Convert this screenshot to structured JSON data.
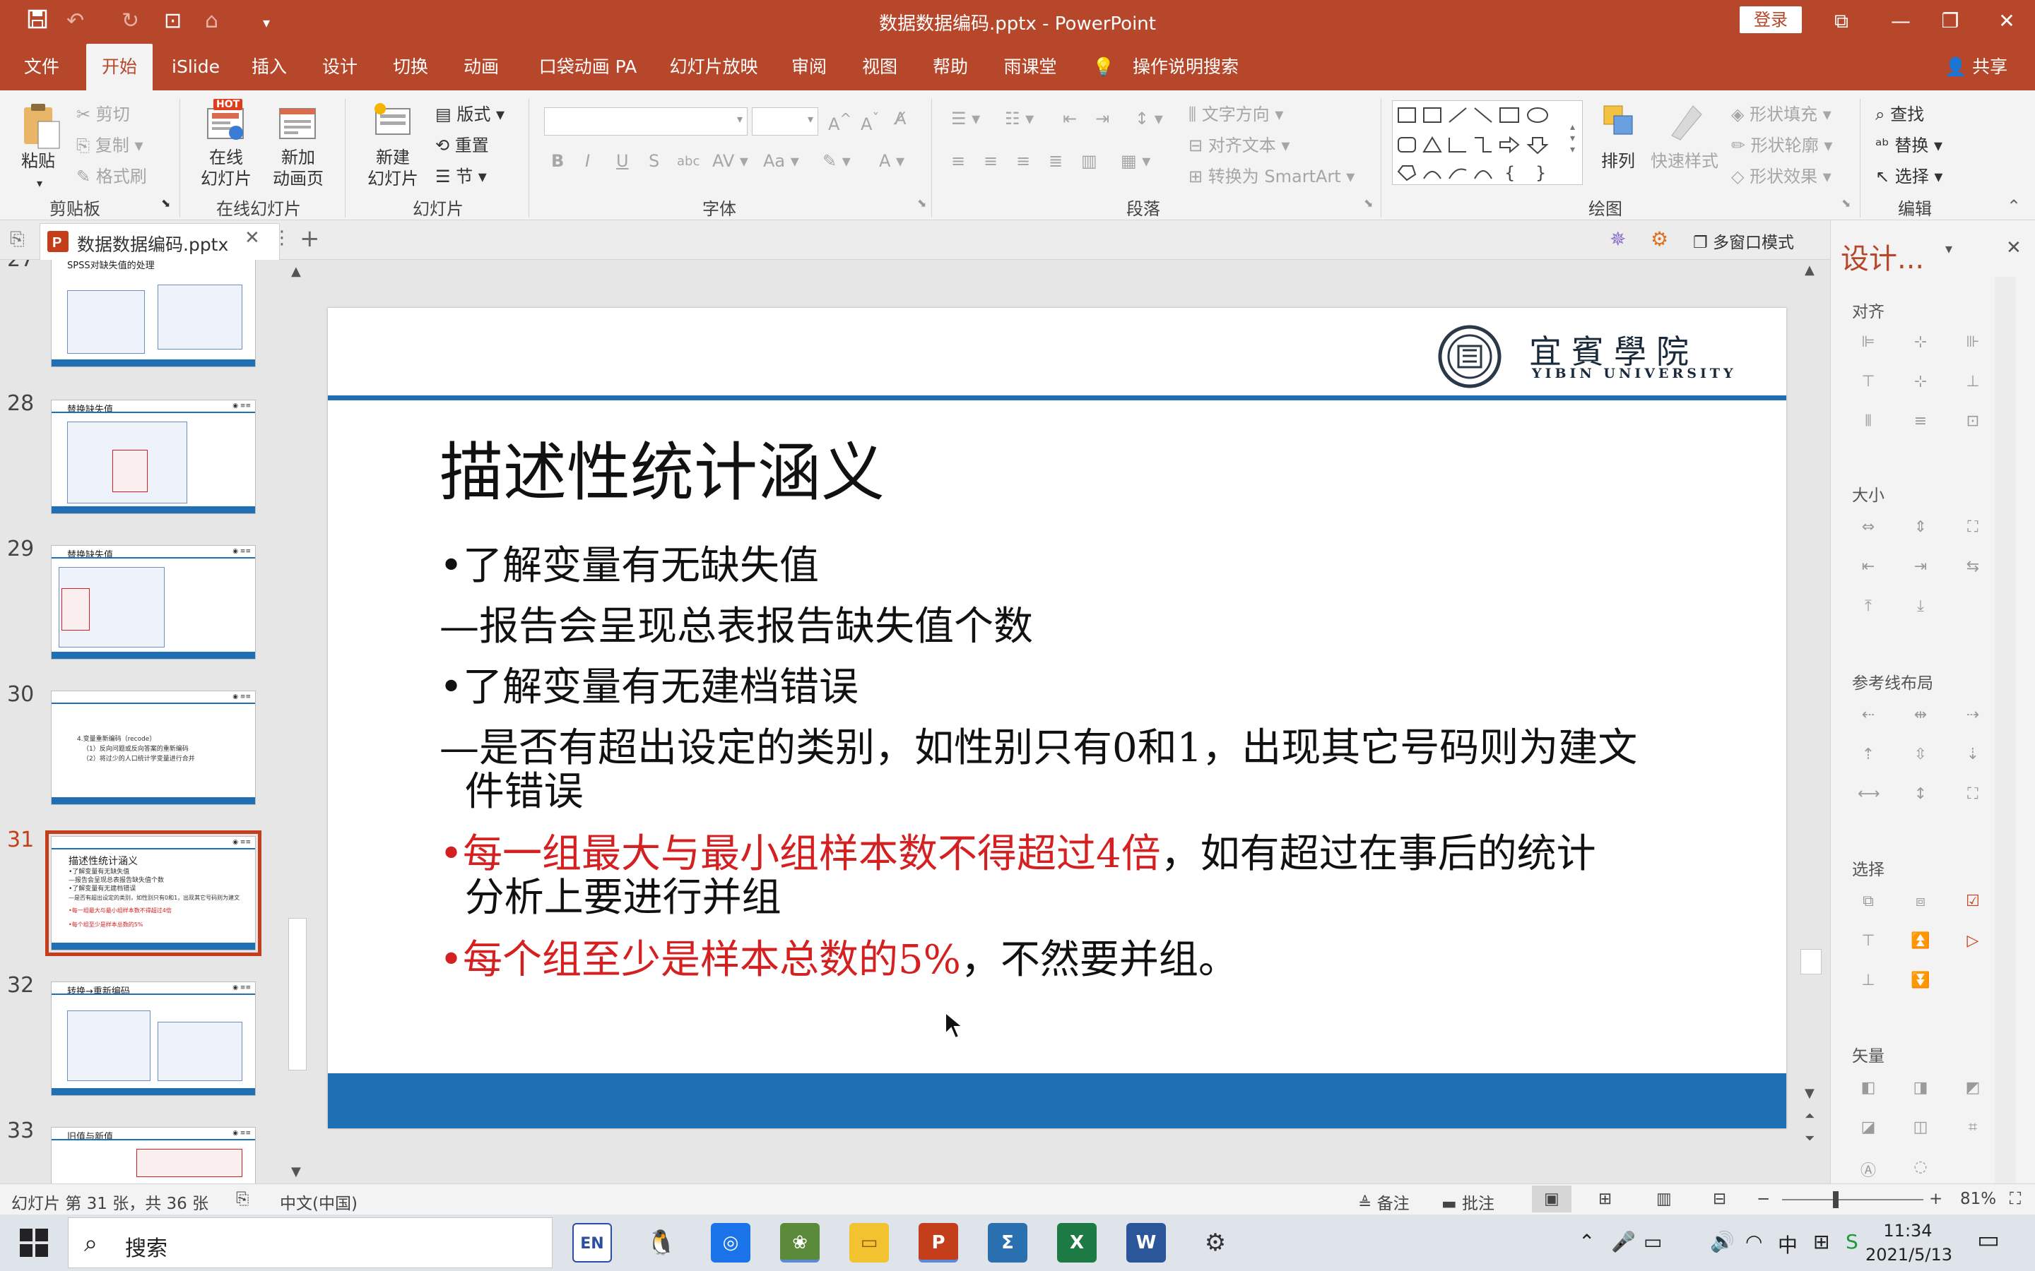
{
  "app": {
    "window_title": "数据数据编码.pptx  -  PowerPoint",
    "login_label": "登录",
    "share_label": "共享"
  },
  "menu_tabs": [
    "文件",
    "开始",
    "iSlide",
    "插入",
    "设计",
    "切换",
    "动画",
    "口袋动画 PA",
    "幻灯片放映",
    "审阅",
    "视图",
    "帮助",
    "雨课堂"
  ],
  "tell_me": "操作说明搜索",
  "ribbon": {
    "clipboard": {
      "label": "剪贴板",
      "paste": "粘贴",
      "cut": "剪切",
      "copy": "复制",
      "format_painter": "格式刷"
    },
    "online_slides": {
      "label": "在线幻灯片",
      "online_slide": "在线\n幻灯片",
      "hot_badge": "HOT",
      "new_animation": "新加\n动画页"
    },
    "slides": {
      "label": "幻灯片",
      "new_slide": "新建\n幻灯片",
      "layout": "版式",
      "reset": "重置",
      "section": "节"
    },
    "font": {
      "label": "字体",
      "font_name": "",
      "font_size": ""
    },
    "paragraph": {
      "label": "段落",
      "text_direction": "文字方向",
      "align_text": "对齐文本",
      "smartart": "转换为 SmartArt"
    },
    "drawing": {
      "label": "绘图",
      "arrange": "排列",
      "quick_styles": "快速样式",
      "shape_fill": "形状填充",
      "shape_outline": "形状轮廓",
      "shape_effects": "形状效果"
    },
    "editing": {
      "label": "编辑",
      "find": "查找",
      "replace": "替换",
      "select": "选择"
    }
  },
  "doc_tab": {
    "label": "数据数据编码.pptx",
    "multiwindow": "多窗口模式"
  },
  "thumbnails": [
    {
      "number": "27",
      "title": "SPSS对缺失值的处理"
    },
    {
      "number": "28",
      "title": "替换缺失值"
    },
    {
      "number": "29",
      "title": "替换缺失值"
    },
    {
      "number": "30",
      "title": "",
      "lines": [
        "4.变量重新编码（recode）",
        "（1）反向问题或反向答案的重新编码",
        "（2）将过少的人口统计学变量进行合并"
      ]
    },
    {
      "number": "31",
      "title": "描述性统计涵义",
      "active": true
    },
    {
      "number": "32",
      "title": "转换→重新编码"
    },
    {
      "number": "33",
      "title": "旧值与新值"
    }
  ],
  "slide": {
    "logo_cn": "宜賓學院",
    "logo_en": "YIBIN UNIVERSITY",
    "title": "描述性统计涵义",
    "lines": [
      {
        "text": "•了解变量有无缺失值"
      },
      {
        "text": "—报告会呈现总表报告缺失值个数"
      },
      {
        "text": "•了解变量有无建档错误"
      },
      {
        "text": "—是否有超出设定的类别，如性别只有0和1，出现其它号码则为建文"
      },
      {
        "text": "  件错误"
      },
      {
        "red": "•每一组最大与最小组样本数不得超过4倍",
        "text": "，如有超过在事后的统计"
      },
      {
        "text": "  分析上要进行并组"
      },
      {
        "red": "•每个组至少是样本总数的5%",
        "text": "，不然要并组。"
      }
    ]
  },
  "design_pane": {
    "title": "设计...",
    "sections": [
      "对齐",
      "大小",
      "参考线布局",
      "选择",
      "矢量"
    ]
  },
  "status": {
    "slide_info": "幻灯片 第 31 张，共 36 张",
    "language": "中文(中国)",
    "notes": "备注",
    "comments": "批注",
    "zoom": "81%"
  },
  "taskbar": {
    "search_placeholder": "搜索",
    "time": "11:34",
    "date": "2021/5/13",
    "ime": "EN"
  },
  "colors": {
    "brand": "#b7472a",
    "slide_blue": "#1f6fb5",
    "highlight_red": "#d42020"
  }
}
